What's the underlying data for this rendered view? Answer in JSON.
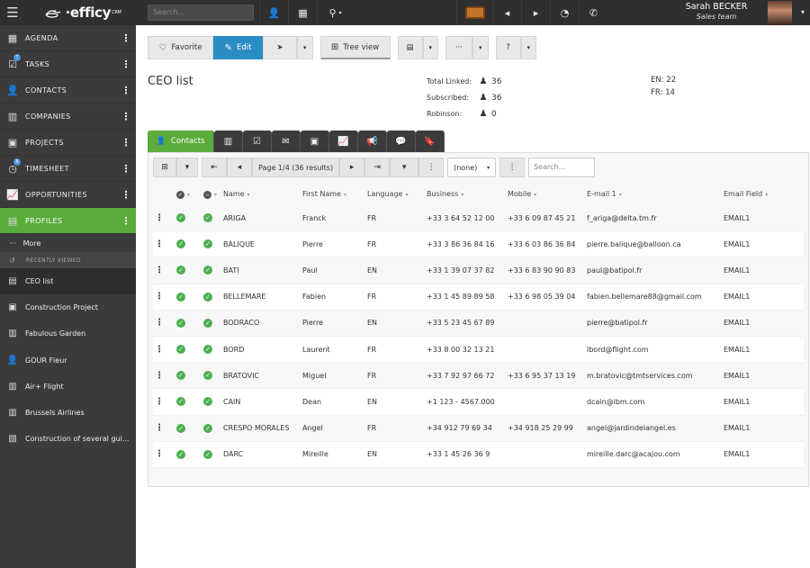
{
  "topbar": {
    "search_placeholder": "Search...",
    "user_name": "Sarah BECKER",
    "user_team": "Sales team"
  },
  "sidebar": {
    "items": [
      {
        "label": "AGENDA",
        "icon": "grid-icon"
      },
      {
        "label": "TASKS",
        "icon": "checkbox-icon",
        "badge": "7"
      },
      {
        "label": "CONTACTS",
        "icon": "contact-icon"
      },
      {
        "label": "COMPANIES",
        "icon": "building-icon"
      },
      {
        "label": "PROJECTS",
        "icon": "briefcase-icon"
      },
      {
        "label": "TIMESHEET",
        "icon": "clock-icon",
        "badge": "8"
      },
      {
        "label": "OPPORTUNITIES",
        "icon": "chart-icon"
      },
      {
        "label": "PROFILES",
        "icon": "profile-icon"
      }
    ],
    "more_label": "More",
    "recently_viewed_label": "RECENTLY VIEWED",
    "recent": [
      {
        "label": "CEO list"
      },
      {
        "label": "Construction Project"
      },
      {
        "label": "Fabulous Garden"
      },
      {
        "label": "GOUR Fleur"
      },
      {
        "label": "Air+ Flight"
      },
      {
        "label": "Brussels Airlines"
      },
      {
        "label": "Construction of several gui..."
      }
    ]
  },
  "toolbar": {
    "favorite_label": "Favorite",
    "edit_label": "Edit",
    "tree_label": "Tree view",
    "more_label": "···"
  },
  "page_title": "CEO list",
  "stats": {
    "total_linked_label": "Total Linked:",
    "total_linked": "36",
    "subscribed_label": "Subscribed:",
    "subscribed": "36",
    "robinson_label": "Robinson:",
    "robinson": "0"
  },
  "lang_stats": {
    "en": "EN: 22",
    "fr": "FR: 14"
  },
  "tabs": {
    "contacts_label": "Contacts"
  },
  "grid": {
    "page_info": "Page 1/4 (36 results)",
    "select_value": "(none)",
    "search_placeholder": "Search...",
    "columns": {
      "name": "Name",
      "first": "First Name",
      "lang": "Language",
      "business": "Business",
      "mobile": "Mobile",
      "email": "E-mail 1",
      "field": "Email Field"
    },
    "rows": [
      {
        "name": "ARIGA",
        "first": "Franck",
        "lang": "FR",
        "business": "+33 3 64 52 12 00",
        "mobile": "+33 6 09 87 45 21",
        "email": "f_ariga@delta.tm.fr",
        "field": "EMAIL1"
      },
      {
        "name": "BALIQUE",
        "first": "Pierre",
        "lang": "FR",
        "business": "+33 3 86 36 84 16",
        "mobile": "+33 6 03 86 36 84",
        "email": "pierre.balique@balloon.ca",
        "field": "EMAIL1"
      },
      {
        "name": "BATI",
        "first": "Paul",
        "lang": "EN",
        "business": "+33 1 39 07 37 82",
        "mobile": "+33 6 83 90 90 83",
        "email": "paul@batipol.fr",
        "field": "EMAIL1"
      },
      {
        "name": "BELLEMARE",
        "first": "Fabien",
        "lang": "FR",
        "business": "+33 1 45 89 89 58",
        "mobile": "+33 6 98 05 39 04",
        "email": "fabien.bellemare88@gmail.com",
        "field": "EMAIL1"
      },
      {
        "name": "BODRACO",
        "first": "Pierre",
        "lang": "EN",
        "business": "+33 5 23 45 67 89",
        "mobile": "",
        "email": "pierre@batipol.fr",
        "field": "EMAIL1"
      },
      {
        "name": "BORD",
        "first": "Laurent",
        "lang": "FR",
        "business": "+33 8 00 32 13 21",
        "mobile": "",
        "email": "lbord@flight.com",
        "field": "EMAIL1"
      },
      {
        "name": "BRATOVIC",
        "first": "Miguel",
        "lang": "FR",
        "business": "+33 7 92 97 66 72",
        "mobile": "+33 6 95 37 13 19",
        "email": "m.bratovic@tmtservices.com",
        "field": "EMAIL1"
      },
      {
        "name": "CAIN",
        "first": "Dean",
        "lang": "EN",
        "business": "+1 123 - 4567.000",
        "mobile": "",
        "email": "dcain@ibm.com",
        "field": "EMAIL1"
      },
      {
        "name": "CRESPO MORALES",
        "first": "Angel",
        "lang": "FR",
        "business": "+34 912 79 69 34",
        "mobile": "+34 918 25 29 99",
        "email": "angel@jardindelangel.es",
        "field": "EMAIL1"
      },
      {
        "name": "DARC",
        "first": "Mireille",
        "lang": "EN",
        "business": "+33 1 45 26 36 9",
        "mobile": "",
        "email": "mireille.darc@acajou.com",
        "field": "EMAIL1"
      }
    ]
  },
  "colors": {
    "accent_green": "#5aac3b",
    "edit_blue": "#2a8cc4",
    "topbar": "#2f2f2f",
    "sidebar": "#3b3b3b"
  }
}
